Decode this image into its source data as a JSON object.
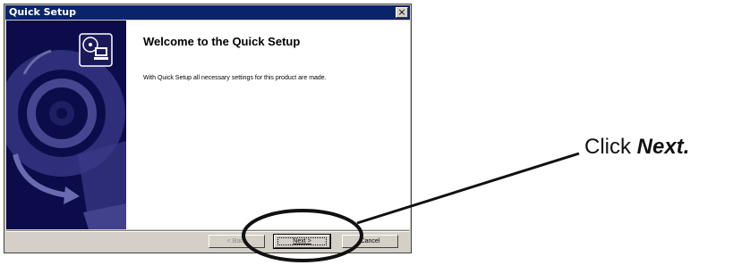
{
  "window": {
    "title": "Quick Setup",
    "close_glyph": "×"
  },
  "content": {
    "heading": "Welcome to the Quick Setup",
    "body": "With Quick Setup all necessary settings for this product are made."
  },
  "buttons": {
    "back": "< Back",
    "next": "Next >",
    "cancel": "Cancel"
  },
  "annotation": {
    "prefix": "Click ",
    "emphasis": "Next."
  },
  "icons": {
    "banner_icon": "setup-computer-icon",
    "banner_art": "cd-disc-computer-illustration"
  },
  "colors": {
    "title_bar": "#0a246a",
    "banner_bg": "#0c0c4a",
    "dialog_face": "#d4d0c8"
  }
}
